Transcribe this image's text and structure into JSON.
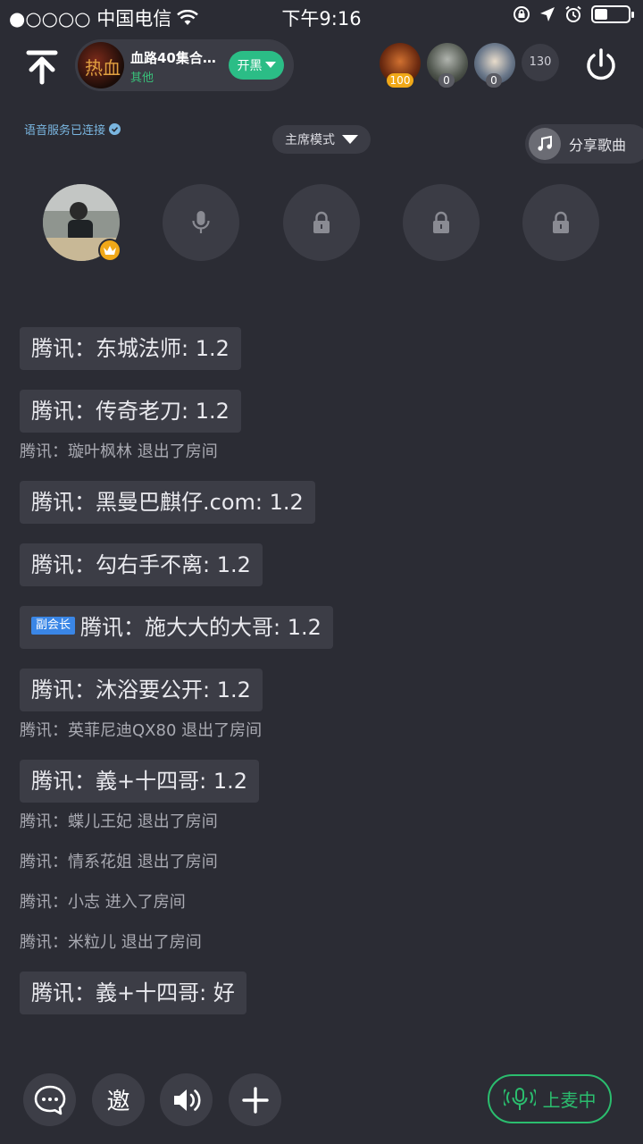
{
  "status_bar": {
    "carrier": "●○○○○ 中国电信",
    "time": "下午9:16"
  },
  "room": {
    "cover_text": "热血",
    "name": "血路40集合…",
    "category": "其他",
    "kaihei_label": "开黑"
  },
  "viewers": [
    {
      "badge": "100",
      "badge_color": "#f0a818"
    },
    {
      "badge": "0",
      "badge_color": "#5a5b63"
    },
    {
      "badge": "0",
      "badge_color": "#5a5b63"
    }
  ],
  "online_count": "130",
  "voice_status": "语音服务已连接",
  "mode": "主席模式",
  "share_song_label": "分享歌曲",
  "seats": [
    {
      "type": "host",
      "icon": "avatar-crown"
    },
    {
      "type": "open",
      "icon": "mic-icon"
    },
    {
      "type": "locked",
      "icon": "lock-icon"
    },
    {
      "type": "locked",
      "icon": "lock-icon"
    },
    {
      "type": "locked",
      "icon": "lock-icon"
    }
  ],
  "chat": [
    {
      "kind": "bubble",
      "text": "腾讯：东城法师: 1.2"
    },
    {
      "kind": "bubble",
      "text": "腾讯：传奇老刀: 1.2"
    },
    {
      "kind": "system",
      "text": "腾讯：璇叶枫林 退出了房间"
    },
    {
      "kind": "bubble",
      "text": "腾讯：黑曼巴麒仔.com: 1.2"
    },
    {
      "kind": "bubble",
      "text": "腾讯：勾右手不离: 1.2"
    },
    {
      "kind": "bubble",
      "badge": "副会长",
      "text": "腾讯：施大大的大哥: 1.2"
    },
    {
      "kind": "bubble",
      "text": "腾讯：沐浴要公开: 1.2"
    },
    {
      "kind": "system",
      "text": "腾讯：英菲尼迪QX80 退出了房间"
    },
    {
      "kind": "bubble",
      "text": "腾讯：義+十四哥: 1.2"
    },
    {
      "kind": "system",
      "text": "腾讯：蝶儿王妃 退出了房间"
    },
    {
      "kind": "system",
      "text": "腾讯：情系花姐 退出了房间"
    },
    {
      "kind": "system",
      "text": "腾讯：小志 进入了房间"
    },
    {
      "kind": "system",
      "text": "腾讯：米粒儿 退出了房间"
    },
    {
      "kind": "bubble",
      "text": "腾讯：義+十四哥: 好"
    }
  ],
  "bottom_bar": {
    "invite_label": "邀",
    "mic_label": "上麦中",
    "accent": "#2bbd6e"
  }
}
